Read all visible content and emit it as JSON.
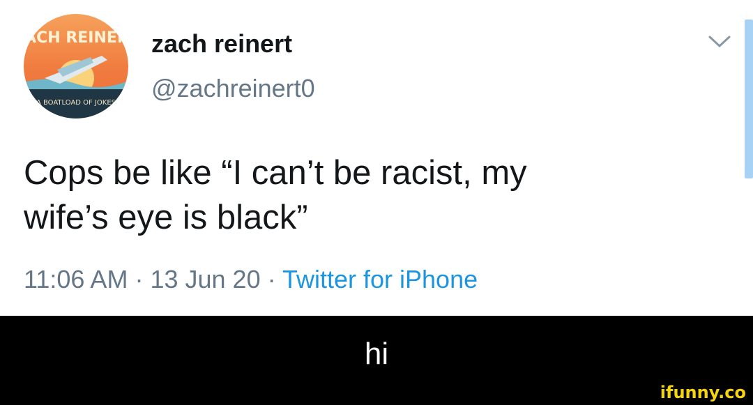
{
  "tweet": {
    "avatar": {
      "top_text": "ZACH REINERT",
      "bottom_text": "A BOATLOAD OF JOKES"
    },
    "author_name": "zach reinert",
    "author_handle": "@zachreinert0",
    "text": "Cops be like “I can’t be racist, my\nwife’s eye is black”",
    "time": "11:06 AM",
    "separator": "·",
    "date": "13 Jun 20",
    "source": "Twitter for iPhone"
  },
  "caption": {
    "text": "hi"
  },
  "watermark": {
    "text": "ifunny.co"
  },
  "colors": {
    "source_link": "#1b95e0",
    "secondary_text": "#657786",
    "primary_text": "#14171a",
    "watermark": "#f5d30f"
  },
  "icons": {
    "menu": "chevron-down-icon"
  }
}
